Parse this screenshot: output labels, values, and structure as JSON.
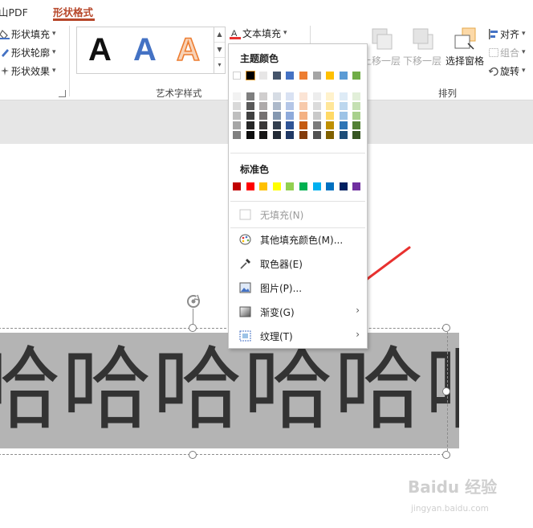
{
  "tabs": [
    {
      "label": "山PDF"
    },
    {
      "label": "形状格式"
    }
  ],
  "ribbon": {
    "shape_fill": "形状填充",
    "shape_outline": "形状轮廓",
    "shape_effects": "形状效果",
    "text_fill": "文本填充",
    "wordart_label": "艺术字样式",
    "wordart_letter": "A",
    "bring_forward": "上移一层",
    "send_backward": "下移一层",
    "selection_pane": "选择窗格",
    "align": "对齐",
    "group": "组合",
    "rotate": "旋转",
    "arrange_label": "排列"
  },
  "dropdown": {
    "theme_colors_title": "主题颜色",
    "standard_colors_title": "标准色",
    "no_fill": "无填充(N)",
    "more_colors": "其他填充颜色(M)...",
    "eyedropper": "取色器(E)",
    "picture": "图片(P)...",
    "gradient": "渐变(G)",
    "texture": "纹理(T)",
    "theme_top": [
      "#ffffff",
      "#000000",
      "#e7e6e6",
      "#44546a",
      "#4472c4",
      "#ed7d31",
      "#a5a5a5",
      "#ffc000",
      "#5b9bd5",
      "#70ad47"
    ],
    "theme_shades": [
      [
        "#f2f2f2",
        "#d9d9d9",
        "#bfbfbf",
        "#a6a6a6",
        "#808080"
      ],
      [
        "#7f7f7f",
        "#595959",
        "#404040",
        "#262626",
        "#0d0d0d"
      ],
      [
        "#d0cece",
        "#aeaaaa",
        "#757171",
        "#3a3838",
        "#171616"
      ],
      [
        "#d6dce4",
        "#adb9ca",
        "#8497b0",
        "#333f4f",
        "#222a35"
      ],
      [
        "#d9e2f3",
        "#b4c6e7",
        "#8eaadb",
        "#2f5496",
        "#1f3864"
      ],
      [
        "#fbe4d5",
        "#f7caac",
        "#f4b183",
        "#c55a11",
        "#833c0b"
      ],
      [
        "#ededed",
        "#dbdbdb",
        "#c9c9c9",
        "#7b7b7b",
        "#525252"
      ],
      [
        "#fff2cc",
        "#ffe699",
        "#ffd966",
        "#bf8f00",
        "#7f6000"
      ],
      [
        "#deebf6",
        "#bdd7ee",
        "#9dc3e6",
        "#2e75b5",
        "#1e4e79"
      ],
      [
        "#e2efd9",
        "#c5e0b3",
        "#a8d08d",
        "#538135",
        "#375623"
      ]
    ],
    "standard": [
      "#c00000",
      "#ff0000",
      "#ffc000",
      "#ffff00",
      "#92d050",
      "#00b050",
      "#00b0f0",
      "#0070c0",
      "#002060",
      "#7030a0"
    ]
  },
  "slide": {
    "text": "哈哈哈哈哈啊"
  },
  "watermark": {
    "line1": "Baidu 经验",
    "line2": "jingyan.baidu.com"
  },
  "colors": {
    "accent_tab": "#b7472a",
    "arrow": "#e8312f"
  }
}
